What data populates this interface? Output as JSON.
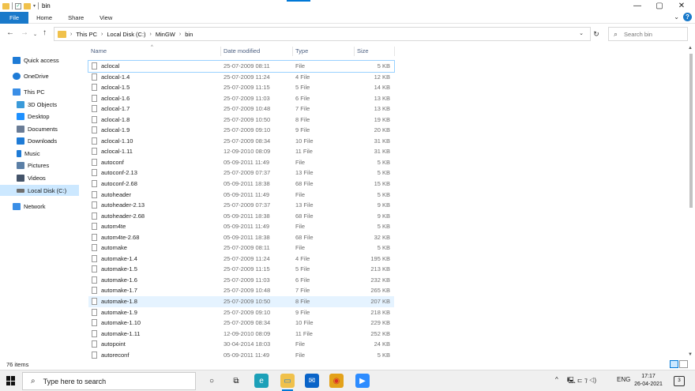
{
  "window": {
    "title": "bin",
    "minimize_glyph": "—",
    "maximize_glyph": "▢",
    "close_glyph": "✕"
  },
  "ribbon": {
    "tabs": [
      "File",
      "Home",
      "Share",
      "View"
    ],
    "help": "?"
  },
  "address": {
    "crumbs": [
      "This PC",
      "Local Disk (C:)",
      "MinGW",
      "bin"
    ],
    "search_placeholder": "Search bin"
  },
  "sidebar": {
    "items": [
      {
        "label": "Quick access",
        "icon": "star-icon",
        "color": "#1e7bd6"
      },
      {
        "label": "OneDrive",
        "icon": "cloud-icon",
        "color": "#1e7bd6"
      },
      {
        "label": "This PC",
        "icon": "computer-icon",
        "color": "#3a8ee6"
      },
      {
        "label": "3D Objects",
        "icon": "cube-icon",
        "color": "#3a9ad9"
      },
      {
        "label": "Desktop",
        "icon": "desktop-icon",
        "color": "#1e90ff"
      },
      {
        "label": "Documents",
        "icon": "document-icon",
        "color": "#6a7c96"
      },
      {
        "label": "Downloads",
        "icon": "download-icon",
        "color": "#1e7bd6"
      },
      {
        "label": "Music",
        "icon": "music-icon",
        "color": "#1e7bd6"
      },
      {
        "label": "Pictures",
        "icon": "picture-icon",
        "color": "#5b7fa6"
      },
      {
        "label": "Videos",
        "icon": "video-icon",
        "color": "#44546a"
      },
      {
        "label": "Local Disk (C:)",
        "icon": "drive-icon",
        "color": "#707070"
      },
      {
        "label": "Network",
        "icon": "network-icon",
        "color": "#3a8ee6"
      }
    ]
  },
  "columns": [
    "Name",
    "Date modified",
    "Type",
    "Size"
  ],
  "files": [
    {
      "name": "aclocal",
      "date": "25-07-2009 08:11",
      "type": "File",
      "size": "5 KB"
    },
    {
      "name": "aclocal-1.4",
      "date": "25-07-2009 11:24",
      "type": "4 File",
      "size": "12 KB"
    },
    {
      "name": "aclocal-1.5",
      "date": "25-07-2009 11:15",
      "type": "5 File",
      "size": "14 KB"
    },
    {
      "name": "aclocal-1.6",
      "date": "25-07-2009 11:03",
      "type": "6 File",
      "size": "13 KB"
    },
    {
      "name": "aclocal-1.7",
      "date": "25-07-2009 10:48",
      "type": "7 File",
      "size": "13 KB"
    },
    {
      "name": "aclocal-1.8",
      "date": "25-07-2009 10:50",
      "type": "8 File",
      "size": "19 KB"
    },
    {
      "name": "aclocal-1.9",
      "date": "25-07-2009 09:10",
      "type": "9 File",
      "size": "20 KB"
    },
    {
      "name": "aclocal-1.10",
      "date": "25-07-2009 08:34",
      "type": "10 File",
      "size": "31 KB"
    },
    {
      "name": "aclocal-1.11",
      "date": "12-09-2010 08:09",
      "type": "11 File",
      "size": "31 KB"
    },
    {
      "name": "autoconf",
      "date": "05-09-2011 11:49",
      "type": "File",
      "size": "5 KB"
    },
    {
      "name": "autoconf-2.13",
      "date": "25-07-2009 07:37",
      "type": "13 File",
      "size": "5 KB"
    },
    {
      "name": "autoconf-2.68",
      "date": "05-09-2011 18:38",
      "type": "68 File",
      "size": "15 KB"
    },
    {
      "name": "autoheader",
      "date": "05-09-2011 11:49",
      "type": "File",
      "size": "5 KB"
    },
    {
      "name": "autoheader-2.13",
      "date": "25-07-2009 07:37",
      "type": "13 File",
      "size": "9 KB"
    },
    {
      "name": "autoheader-2.68",
      "date": "05-09-2011 18:38",
      "type": "68 File",
      "size": "9 KB"
    },
    {
      "name": "autom4te",
      "date": "05-09-2011 11:49",
      "type": "File",
      "size": "5 KB"
    },
    {
      "name": "autom4te-2.68",
      "date": "05-09-2011 18:38",
      "type": "68 File",
      "size": "32 KB"
    },
    {
      "name": "automake",
      "date": "25-07-2009 08:11",
      "type": "File",
      "size": "5 KB"
    },
    {
      "name": "automake-1.4",
      "date": "25-07-2009 11:24",
      "type": "4 File",
      "size": "195 KB"
    },
    {
      "name": "automake-1.5",
      "date": "25-07-2009 11:15",
      "type": "5 File",
      "size": "213 KB"
    },
    {
      "name": "automake-1.6",
      "date": "25-07-2009 11:03",
      "type": "6 File",
      "size": "232 KB"
    },
    {
      "name": "automake-1.7",
      "date": "25-07-2009 10:48",
      "type": "7 File",
      "size": "265 KB"
    },
    {
      "name": "automake-1.8",
      "date": "25-07-2009 10:50",
      "type": "8 File",
      "size": "207 KB"
    },
    {
      "name": "automake-1.9",
      "date": "25-07-2009 09:10",
      "type": "9 File",
      "size": "218 KB"
    },
    {
      "name": "automake-1.10",
      "date": "25-07-2009 08:34",
      "type": "10 File",
      "size": "229 KB"
    },
    {
      "name": "automake-1.11",
      "date": "12-09-2010 08:09",
      "type": "11 File",
      "size": "252 KB"
    },
    {
      "name": "autopoint",
      "date": "30-04-2014 18:03",
      "type": "File",
      "size": "24 KB"
    },
    {
      "name": "autoreconf",
      "date": "05-09-2011 11:49",
      "type": "File",
      "size": "5 KB"
    }
  ],
  "selected_index": 0,
  "hover_index": 22,
  "status": {
    "item_count": "76 items"
  },
  "taskbar": {
    "search_placeholder": "Type here to search",
    "apps": [
      {
        "name": "cortana-icon",
        "glyph": "○",
        "color": "transparent",
        "fg": "#111"
      },
      {
        "name": "task-view-icon",
        "glyph": "⧉",
        "color": "transparent",
        "fg": "#111"
      },
      {
        "name": "edge-icon",
        "glyph": "e",
        "color": "#1ca0b8",
        "fg": "#fff"
      },
      {
        "name": "file-explorer-icon",
        "glyph": "▭",
        "color": "#f0c14b",
        "fg": "#1e7bd6"
      },
      {
        "name": "mail-icon",
        "glyph": "✉",
        "color": "#0a64c8",
        "fg": "#fff"
      },
      {
        "name": "chrome-icon",
        "glyph": "◉",
        "color": "#e3a21a",
        "fg": "#d93025"
      },
      {
        "name": "zoom-icon",
        "glyph": "▶",
        "color": "#2d8cff",
        "fg": "#fff"
      }
    ],
    "tray_chevron": "^",
    "tray_misc": "🖳 ⊏ ⁊ ◁)",
    "lang": "ENG",
    "time": "17:17",
    "date": "26-04-2021",
    "notifications": "3"
  }
}
